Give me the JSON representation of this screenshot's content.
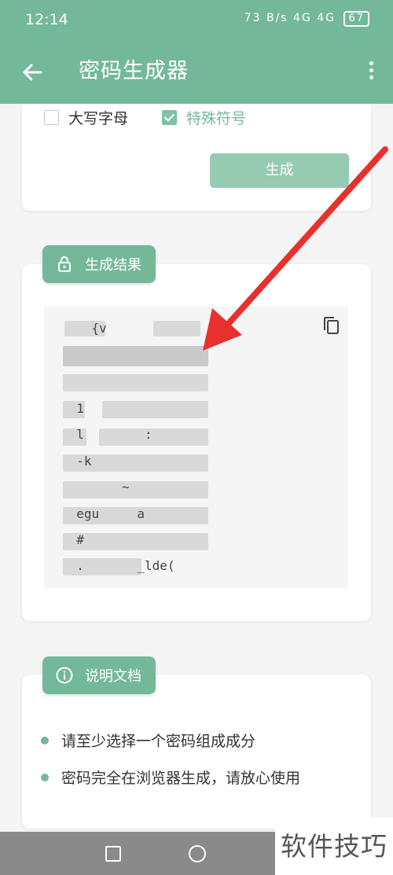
{
  "status_bar": {
    "time": "12:14",
    "icons_text": "73 B/s  4G  4G",
    "battery": "67"
  },
  "app_bar": {
    "title": "密码生成器",
    "back_icon": "arrow-left-icon",
    "menu_icon": "more-vertical-icon"
  },
  "options": {
    "uppercase": {
      "label": "大写字母",
      "checked": false
    },
    "special": {
      "label": "特殊符号",
      "checked": true
    },
    "generate_label": "生成"
  },
  "result": {
    "header": "生成结果",
    "header_icon": "lock-icon",
    "copy_icon": "copy-icon",
    "lines": [
      "    {v",
      "",
      "",
      "  1",
      "  l        :",
      "  -k",
      "        ~",
      "  egu     a",
      "  #",
      "  .       _lde("
    ]
  },
  "docs": {
    "header": "说明文档",
    "header_icon": "info-icon",
    "items": [
      "请至少选择一个密码组成成分",
      "密码完全在浏览器生成，请放心使用"
    ]
  },
  "watermark": "软件技巧",
  "colors": {
    "primary": "#74b89a",
    "button": "#96cbb1",
    "arrow": "#e8302c"
  }
}
